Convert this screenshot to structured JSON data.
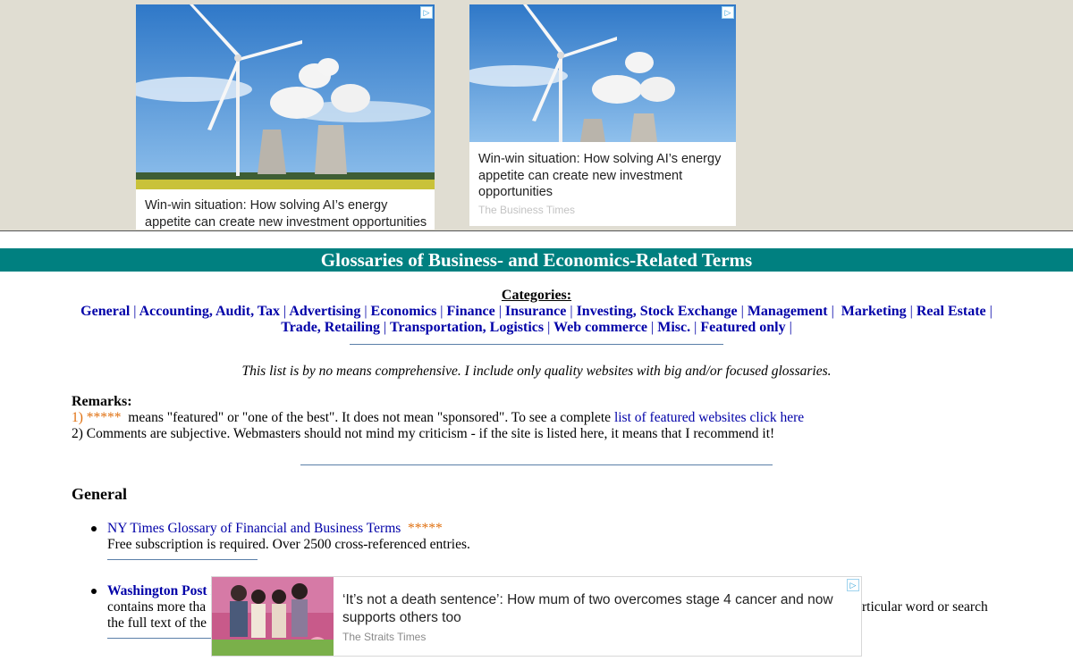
{
  "ads": {
    "ad1": {
      "caption": "Win-win situation: How solving AI’s energy appetite can create new investment opportunities"
    },
    "ad2": {
      "caption": "Win-win situation: How solving AI’s energy appetite can create new investment opportunities",
      "source": "The Business Times"
    },
    "bottom": {
      "headline": "‘It’s not a death sentence’: How mum of two overcomes stage 4 cancer and now supports others too",
      "source": "The Straits Times"
    },
    "adchoices_icon": "adchoices-icon"
  },
  "page": {
    "title": "Glossaries of Business- and Economics-Related Terms",
    "categories_heading": "Categories:",
    "categories": [
      "General",
      "Accounting, Audit, Tax",
      "Advertising",
      "Economics",
      "Finance",
      "Insurance",
      "Investing, Stock Exchange",
      "Management",
      "Marketing",
      "Real Estate",
      "Trade, Retailing",
      "Transportation, Logistics",
      "Web commerce",
      "Misc.",
      "Featured only"
    ],
    "intro": "This list is by no means comprehensive. I include only quality websites with big and/or  focused glossaries.",
    "remarks_heading": "Remarks:",
    "remark1_prefix": "1) *****",
    "remark1_text": "means \"featured\" or \"one of the best\". It does not mean \"sponsored\". To see a complete",
    "remark1_link": "list of featured websites click here",
    "remark2": "2) Comments are subjective. Webmasters should not mind my criticism -  if the site is listed here, it means that I recommend it!"
  },
  "general": {
    "heading": "General",
    "items": [
      {
        "title": "NY Times Glossary of Financial and Business Terms",
        "stars": "*****",
        "desc": "Free subscription is required. Over 2500 cross-referenced entries."
      },
      {
        "title": "Washington Post I",
        "desc_line1_left": "contains more tha",
        "desc_line1_right": "rticular word or search",
        "desc_line2_left": "the full text of the"
      }
    ]
  },
  "colors": {
    "title_bar": "#008080",
    "link": "#0000a8",
    "featured_star": "#e07010",
    "ad_band": "#e0ddd2"
  }
}
